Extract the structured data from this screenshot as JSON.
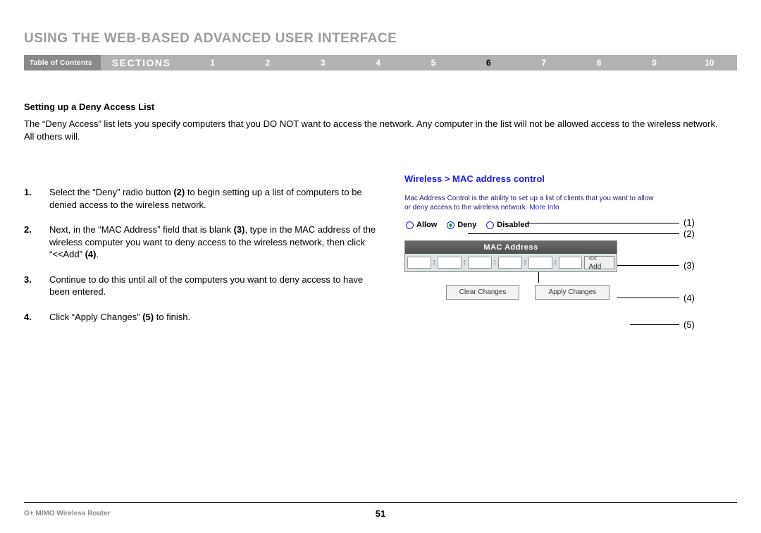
{
  "page_title": "USING THE WEB-BASED ADVANCED USER INTERFACE",
  "nav": {
    "toc_label": "Table of Contents",
    "sections_label": "SECTIONS",
    "items": [
      "1",
      "2",
      "3",
      "4",
      "5",
      "6",
      "7",
      "8",
      "9",
      "10"
    ],
    "active_index": 5
  },
  "section": {
    "subheading": "Setting up a Deny Access List",
    "intro": "The “Deny Access” list lets you specify computers that you DO NOT want to access the network. Any computer in the list will not be allowed access to the wireless network. All others will.",
    "steps": [
      {
        "pre": "Select the “Deny” radio button ",
        "bold": "(2)",
        "post": " to begin setting up a list of computers to be denied access to the wireless network."
      },
      {
        "pre": "Next, in the “MAC Address” field that is blank ",
        "bold": "(3)",
        "mid": ", type in the MAC address of the wireless computer you want to deny access to the wireless network, then click “<<Add” ",
        "bold2": "(4)",
        "post": "."
      },
      {
        "pre": "Continue to do this until all of the computers you want to deny access to have been entered.",
        "bold": "",
        "post": ""
      },
      {
        "pre": "Click “Apply Changes” ",
        "bold": "(5)",
        "post": " to finish."
      }
    ]
  },
  "figure": {
    "breadcrumb": "Wireless > MAC address control",
    "desc_pre": "Mac Address Control is the ability to set up a list of clients that you want to allow or deny access to the wireless network. ",
    "more_info": "More Info",
    "radios": {
      "allow": "Allow",
      "deny": "Deny",
      "disabled": "Disabled",
      "selected": "deny"
    },
    "mac_header": "MAC Address",
    "add_btn": "<< Add",
    "clear_btn": "Clear Changes",
    "apply_btn": "Apply Changes",
    "callouts": {
      "c1": "(1)",
      "c2": "(2)",
      "c3": "(3)",
      "c4": "(4)",
      "c5": "(5)"
    }
  },
  "footer": {
    "product": "G+ MIMO Wireless Router",
    "page_number": "51"
  }
}
